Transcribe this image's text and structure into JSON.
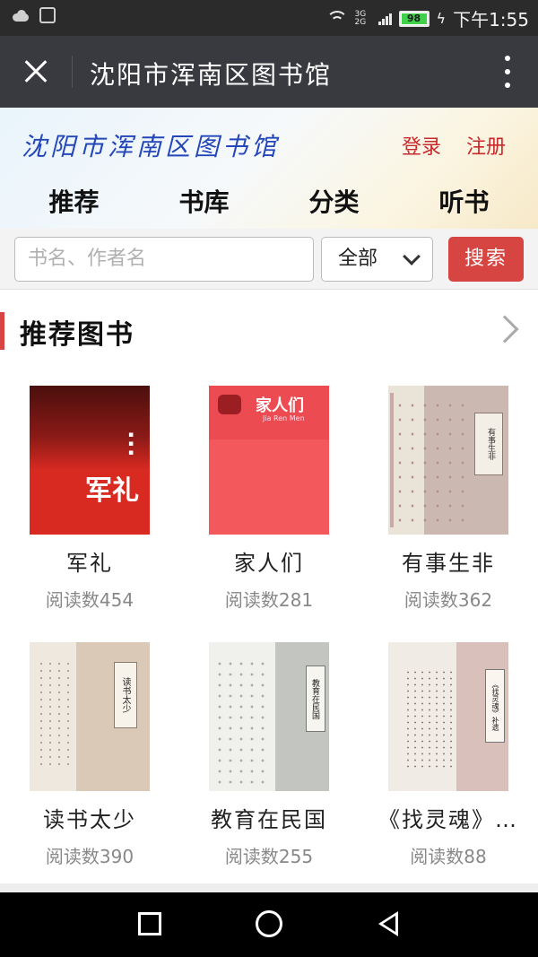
{
  "status_bar": {
    "battery": "98",
    "network": "3G 2G",
    "time": "下午1:55"
  },
  "titlebar": {
    "title": "沈阳市浑南区图书馆"
  },
  "header": {
    "site_name": "沈阳市浑南区图书馆",
    "login": "登录",
    "register": "注册",
    "nav": [
      "推荐",
      "书库",
      "分类",
      "听书"
    ]
  },
  "search": {
    "placeholder": "书名、作者名",
    "scope": "全部",
    "button": "搜索"
  },
  "section": {
    "title": "推荐图书"
  },
  "books": [
    {
      "title": "军礼",
      "reads": "阅读数454",
      "cover_text": "军礼"
    },
    {
      "title": "家人们",
      "reads": "阅读数281",
      "cover_text": "家人们",
      "cover_sub": "Jia Ren Men"
    },
    {
      "title": "有事生非",
      "reads": "阅读数362",
      "cover_text": "有事生非"
    },
    {
      "title": "读书太少",
      "reads": "阅读数390",
      "cover_text": "读书太少"
    },
    {
      "title": "教育在民国",
      "reads": "阅读数255",
      "cover_text": "教育在民国"
    },
    {
      "title": "《找灵魂》…",
      "reads": "阅读数88",
      "cover_text": "《找灵魂》补遗"
    }
  ],
  "colors": {
    "accent_red": "#d64541",
    "titlebar": "#393a3f",
    "site_name_blue": "#2346b8"
  }
}
